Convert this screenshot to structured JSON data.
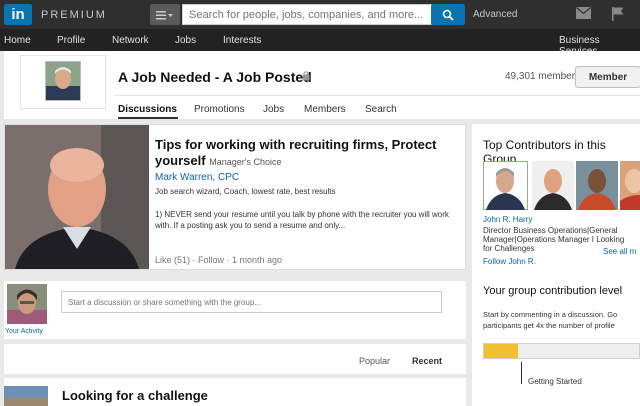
{
  "header": {
    "logo_text": "in",
    "premium": "PREMIUM",
    "search_placeholder": "Search for people, jobs, companies, and more...",
    "advanced": "Advanced"
  },
  "nav": [
    "Home",
    "Profile",
    "Network",
    "Jobs",
    "Interests",
    "Business Services"
  ],
  "group": {
    "title": "A Job Needed - A Job Posted",
    "members": "49,301 members",
    "member_button": "Member",
    "tabs": [
      "Discussions",
      "Promotions",
      "Jobs",
      "Members",
      "Search"
    ]
  },
  "featured": {
    "title": "Tips for working with recruiting firms, Protect yourself",
    "badge": "Manager's Choice",
    "author": "Mark Warren, CPC",
    "tagline": "Job search wizard, Coach, lowest rate, best results",
    "excerpt": "1) NEVER send your resume until you talk by phone with the recruiter you will work with. If a posting ask you to send a resume and only...",
    "meta": "Like (51) · Follow · 1 month ago"
  },
  "share": {
    "placeholder": "Start a discussion or share something with the group...",
    "your_activity": "Your Activity"
  },
  "sort": {
    "popular": "Popular",
    "recent": "Recent"
  },
  "list": {
    "title": "Looking for a challenge"
  },
  "top_contributors": {
    "title": "Top Contributors in this Group",
    "name": "John R. Harry",
    "desc": "Director Business Operations|General Manager|Operations Manager I Looking for Challenges",
    "follow": "Follow John R.",
    "see_more": "See all m"
  },
  "contribution": {
    "title": "Your group contribution level",
    "text": "Start by commenting in a discussion. Go participants get 4x the number of profile",
    "level": "Getting Started",
    "progress": 0.22
  },
  "colors": {
    "brand": "#0a73b2",
    "progress": "#f2c02e"
  }
}
